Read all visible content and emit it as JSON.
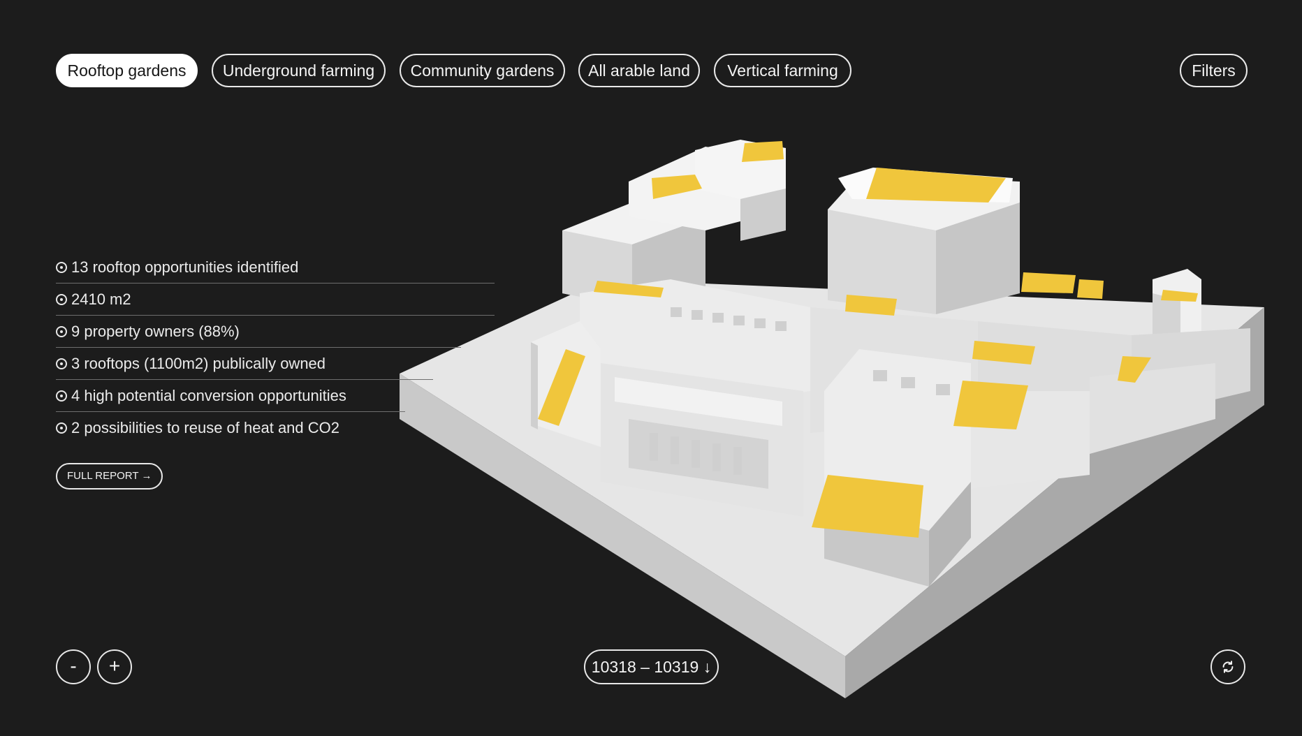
{
  "filters_bar": {
    "tabs": [
      {
        "label": "Rooftop gardens",
        "active": true
      },
      {
        "label": "Underground farming",
        "active": false
      },
      {
        "label": "Community gardens",
        "active": false
      },
      {
        "label": "All arable land",
        "active": false
      },
      {
        "label": "Vertical  farming",
        "active": false
      }
    ],
    "filters_label": "Filters"
  },
  "stats": [
    "13 rooftop opportunities identified",
    "2410 m2",
    "9 property owners  (88%)",
    "3 rooftops (1100m2) publically owned",
    "4 high potential conversion opportunities",
    "2 possibilities to reuse of heat and CO2"
  ],
  "report_button": {
    "label": "FULL REPORT",
    "arrow": "→"
  },
  "zoom": {
    "out_label": "-",
    "in_label": "+"
  },
  "range": {
    "label": "10318 – 10319",
    "arrow": "↓"
  },
  "rotate_icon": "rotate-icon",
  "colors": {
    "background": "#1c1c1c",
    "model": "#e9e9e9",
    "highlight": "#f0c63c",
    "text": "#f2f2f2"
  }
}
